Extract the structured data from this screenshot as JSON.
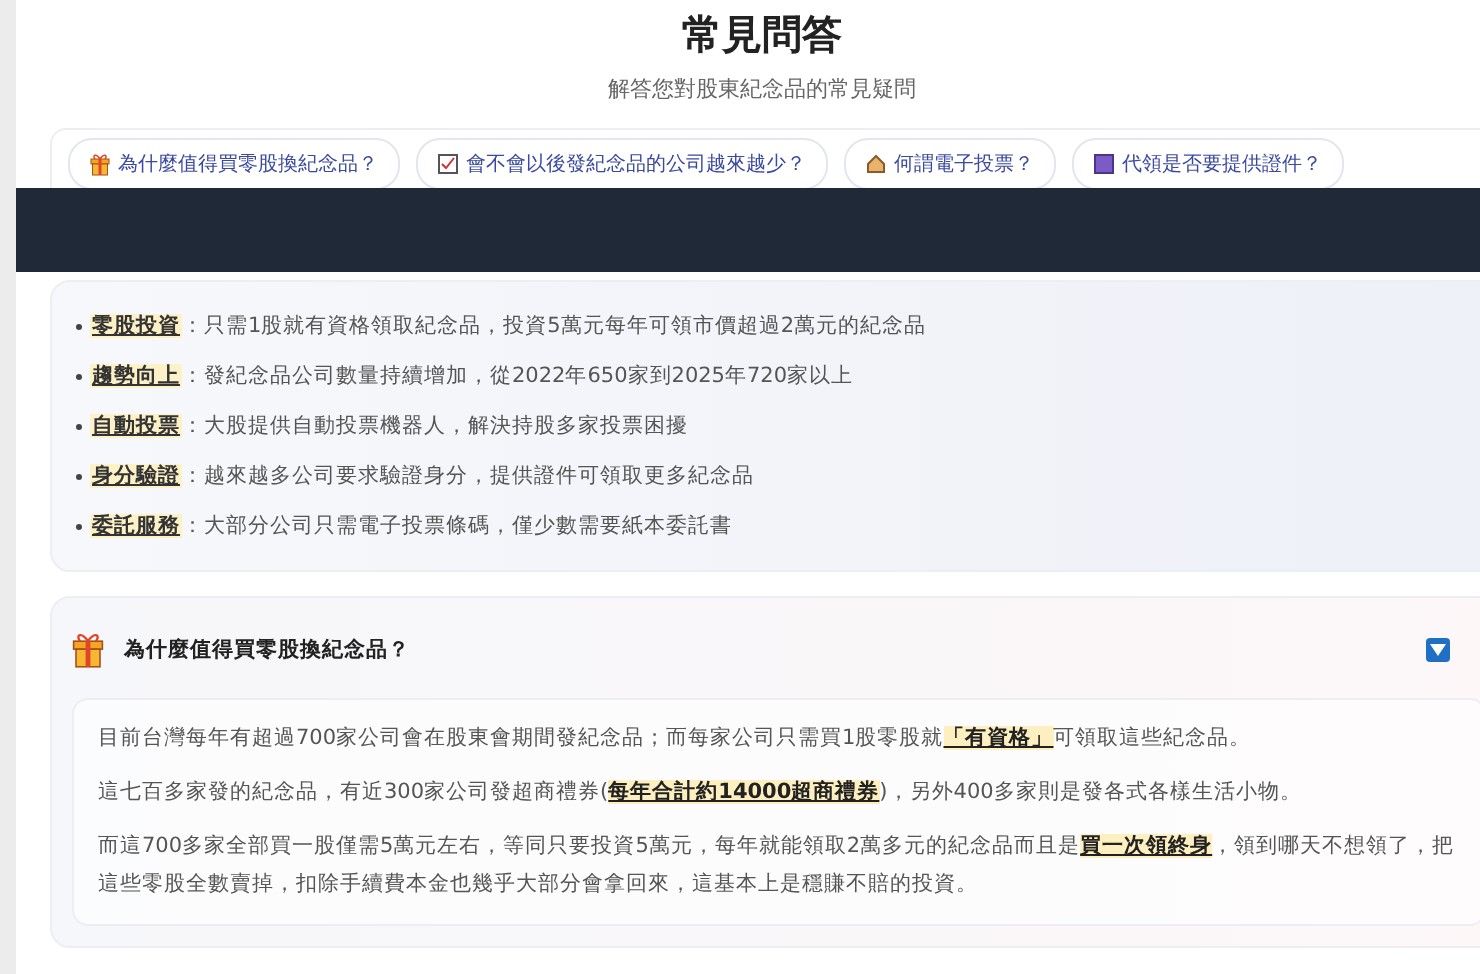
{
  "header": {
    "title": "常見問答",
    "subtitle": "解答您對股東紀念品的常見疑問"
  },
  "quick_links": [
    {
      "label": "為什麼值得買零股換紀念品？"
    },
    {
      "label": "會不會以後發紀念品的公司越來越少？"
    },
    {
      "label": "何謂電子投票？"
    },
    {
      "label": "代領是否要提供證件？"
    }
  ],
  "highlights": [
    "**零股投資**：只需1股就有資格領取紀念品，投資5萬元每年可領市價超過2萬元的紀念品",
    "**趨勢向上**：發紀念品公司數量持續增加，從2022年650家到2025年720家以上",
    "**自動投票**：大股提供自動投票機器人，解決持股多家投票困擾",
    "**身分驗證**：越來越多公司要求驗證身分，提供證件可領取更多紀念品",
    "**委託服務**：大部分公司只需電子投票條碼，僅少數需要紙本委託書"
  ],
  "faq": [
    {
      "question": "為什麼值得買零股換紀念品？",
      "expanded": true,
      "answer": [
        "目前台灣每年有超過700家公司會在股東會期間發紀念品；而每家公司只需買1股零股就**「有資格」**可領取這些紀念品。",
        "這七百多家發的紀念品，有近300家公司發超商禮券(**每年合計約14000超商禮券**)，另外400多家則是發各式各樣生活小物。",
        "而這700多家全部買一股僅需5萬元左右，等同只要投資5萬元，每年就能領取2萬多元的紀念品而且是**買一次領終身**，領到哪天不想領了，把這些零股全數賣掉，扣除手續費本金也幾乎大部分會拿回來，這基本上是穩賺不賠的投資。"
      ]
    }
  ]
}
